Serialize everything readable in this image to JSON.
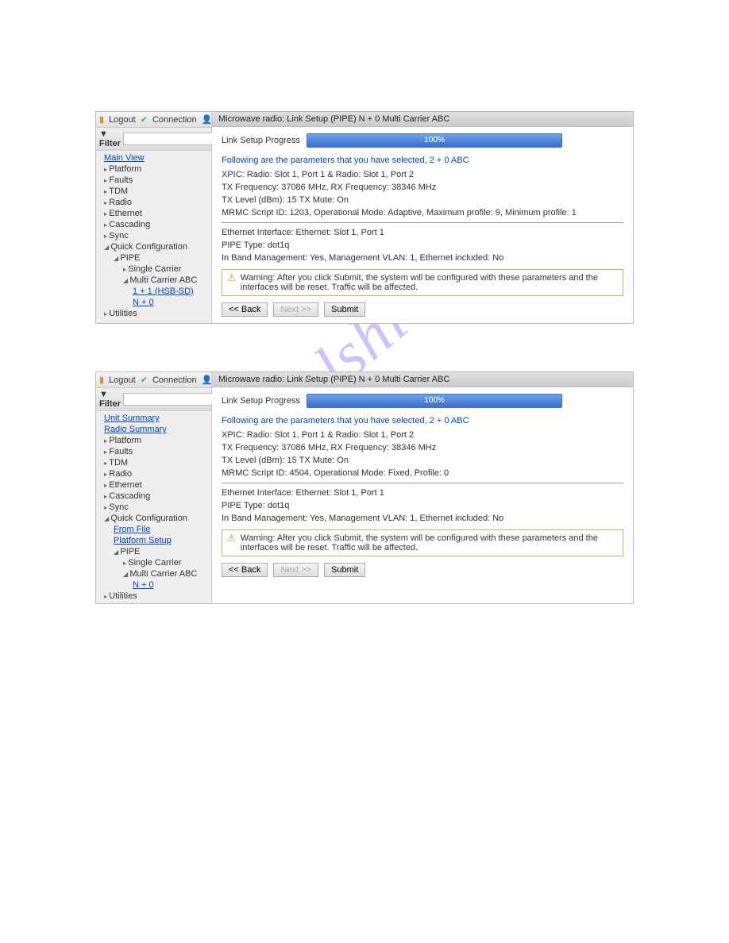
{
  "watermark": "manualshive.com",
  "topbar": {
    "logout": "Logout",
    "connection": "Connection",
    "admin": "Admin"
  },
  "filter": {
    "label": "▼ Filter",
    "clear": "x"
  },
  "panel1": {
    "tree": {
      "main_view": "Main View",
      "platform": "Platform",
      "faults": "Faults",
      "tdm": "TDM",
      "radio": "Radio",
      "ethernet": "Ethernet",
      "cascading": "Cascading",
      "sync": "Sync",
      "quick": "Quick Configuration",
      "pipe": "PIPE",
      "single": "Single Carrier",
      "multi": "Multi Carrier ABC",
      "hsb": "1 + 1 (HSB-SD)",
      "n0": "N + 0",
      "utilities": "Utilities"
    },
    "title": "Microwave radio: Link Setup (PIPE) N + 0 Multi Carrier ABC",
    "progress_label": "Link Setup Progress",
    "progress_value": "100%",
    "selected_header": "Following are the parameters that you have selected, 2 + 0 ABC",
    "xpic": "XPIC: Radio: Slot 1, Port 1 & Radio: Slot 1, Port 2",
    "txfreq": "TX Frequency: 37086 MHz, RX Frequency: 38346 MHz",
    "txlevel": "TX Level (dBm): 15 TX Mute: On",
    "mrmc": "MRMC Script ID: 1203, Operational Mode: Adaptive, Maximum profile: 9, Minimum profile: 1",
    "ethif": "Ethernet Interface: Ethernet: Slot 1, Port 1",
    "pipetype": "PIPE Type: dot1q",
    "inband": "In Band Management: Yes, Management VLAN: 1, Ethernet included: No",
    "warn": "Warning: After you click Submit, the system will be configured with these parameters and the interfaces will be reset. Traffic will be affected.",
    "back": "<< Back",
    "next": "Next >>",
    "submit": "Submit"
  },
  "panel2": {
    "tree": {
      "unit": "Unit Summary",
      "radio_sum": "Radio Summary",
      "platform": "Platform",
      "faults": "Faults",
      "tdm": "TDM",
      "radio": "Radio",
      "ethernet": "Ethernet",
      "cascading": "Cascading",
      "sync": "Sync",
      "quick": "Quick Configuration",
      "from_file": "From File",
      "platform_setup": "Platform Setup",
      "pipe": "PIPE",
      "single": "Single Carrier",
      "multi": "Multi Carrier ABC",
      "n0": "N + 0",
      "utilities": "Utilities"
    },
    "title": "Microwave radio: Link Setup (PIPE) N + 0 Multi Carrier ABC",
    "progress_label": "Link Setup Progress",
    "progress_value": "100%",
    "selected_header": "Following are the parameters that you have selected, 2 + 0 ABC",
    "xpic": "XPIC: Radio: Slot 1, Port 1 & Radio: Slot 1, Port 2",
    "txfreq": "TX Frequency: 37086 MHz, RX Frequency: 38346 MHz",
    "txlevel": "TX Level (dBm): 15 TX Mute: On",
    "mrmc": "MRMC Script ID: 4504, Operational Mode: Fixed, Profile: 0",
    "ethif": "Ethernet Interface: Ethernet: Slot 1, Port 1",
    "pipetype": "PIPE Type: dot1q",
    "inband": "In Band Management: Yes, Management VLAN: 1, Ethernet included: No",
    "warn": "Warning: After you click Submit, the system will be configured with these parameters and the interfaces will be reset. Traffic will be affected.",
    "back": "<< Back",
    "next": "Next >>",
    "submit": "Submit"
  }
}
